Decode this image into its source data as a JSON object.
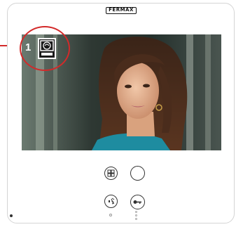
{
  "device": {
    "brand_logo": "FERMAX"
  },
  "screen": {
    "content": "video-feed-visitor",
    "status_icon": "monitor-call-icon"
  },
  "annotation": {
    "number": "1",
    "circle_color": "#d32a2a"
  },
  "controls": {
    "menu_icon": "grid-menu-icon",
    "home_icon": "round-button-icon",
    "audio_icon": "speaker-call-icon",
    "door_icon": "key-door-open-icon"
  },
  "colors": {
    "annotation": "#d32a2a",
    "icon_stroke": "#333333"
  }
}
